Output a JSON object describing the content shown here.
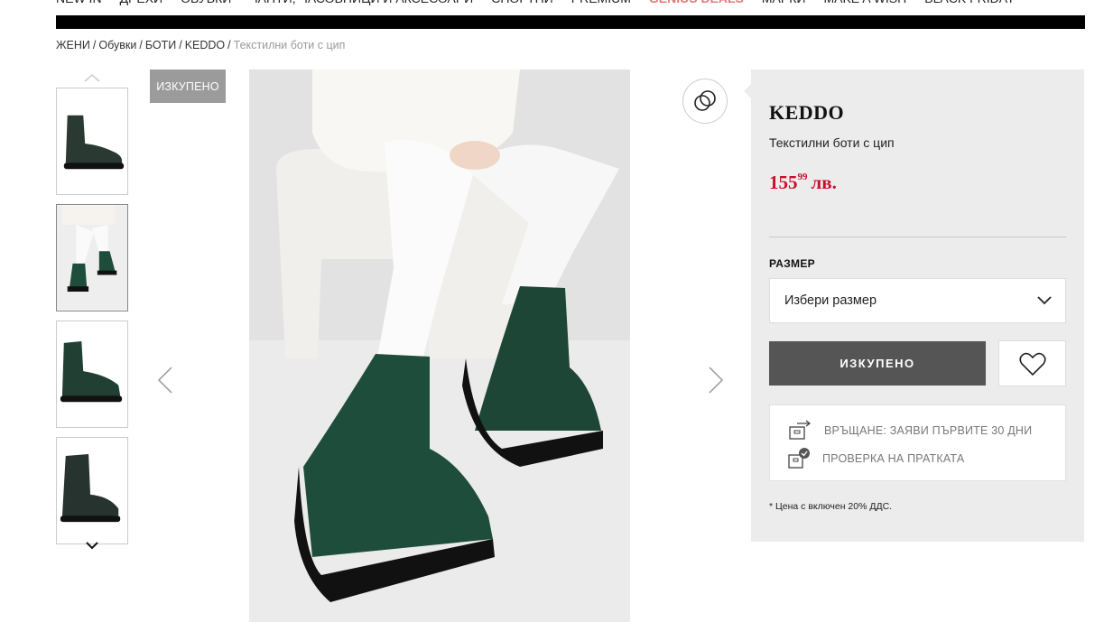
{
  "nav": {
    "items": [
      "NEW IN",
      "ДРЕХИ",
      "ОБУВКИ",
      "ЧАНТИ, ЧАСОВНИЦИ И АКСЕСОАРИ",
      "СПОРТНИ",
      "PREMIUM",
      "GENIUS DEALS",
      "МАРКИ",
      "MAKE A WISH",
      "BLACK FRIDAY"
    ]
  },
  "breadcrumb": {
    "items": [
      "ЖЕНИ",
      "Обувки",
      "БОТИ",
      "KEDDO"
    ],
    "separator": "/",
    "current": "Текстилни боти с цип"
  },
  "gallery": {
    "sold_badge": "ИЗКУПЕНО",
    "thumbnail_count": 4,
    "active_thumbnail": 2
  },
  "product": {
    "brand": "KEDDO",
    "name": "Текстилни боти с цип",
    "price_main": "155",
    "price_cents": "99",
    "currency": "лв.",
    "size_label": "РАЗМЕР",
    "size_placeholder": "Избери размер",
    "buy_label": "ИЗКУПЕНО",
    "returns_text": "ВРЪЩАНЕ: ЗАЯВИ ПЪРВИТЕ 30 ДНИ",
    "check_text": "ПРОВЕРКА НА ПРАТКАТА",
    "vat_note": "* Цена с включен 20% ДДС."
  },
  "colors": {
    "price": "#c8102e",
    "panel_bg": "#ececec",
    "buy_button": "#555555",
    "boot_green": "#1f4d3c"
  },
  "icons": {
    "compare": "compare-rings-icon",
    "wishlist": "heart-icon",
    "returns": "return-box-icon",
    "check": "package-check-icon"
  }
}
